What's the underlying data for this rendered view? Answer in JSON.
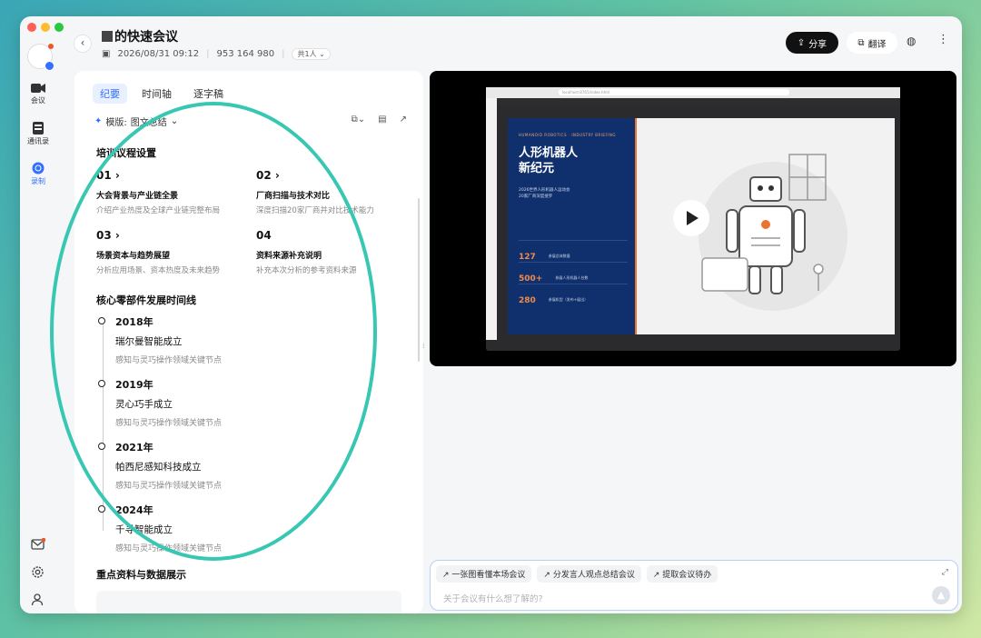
{
  "colors": {
    "accent": "#3370ff",
    "annotation": "#38c7b3",
    "slide_navy": "#10306d",
    "slide_orange": "#e8742f"
  },
  "sidebar": {
    "items": [
      {
        "label": "会议",
        "icon": "video-camera-icon"
      },
      {
        "label": "通讯录",
        "icon": "contacts-icon"
      },
      {
        "label": "录制",
        "icon": "record-icon"
      }
    ],
    "bottom_icons": [
      "mail-icon",
      "gear-icon",
      "person-icon"
    ]
  },
  "header": {
    "title": "的快速会议",
    "datetime": "2026/08/31 09:12",
    "meeting_id": "953 164 980",
    "participants": "共1人",
    "share_label": "分享",
    "translate_label": "翻译"
  },
  "panel": {
    "tabs": [
      "纪要",
      "时间轴",
      "逐字稿"
    ],
    "template_label": "模版:",
    "template_value": "图文总结",
    "section_agenda": "培训议程设置",
    "agenda": [
      {
        "num": "01 ›",
        "title": "大会背景与产业链全景",
        "desc": "介绍产业热度及全球产业链完整布局"
      },
      {
        "num": "02 ›",
        "title": "厂商扫描与技术对比",
        "desc": "深度扫描20家厂商并对比技术能力"
      },
      {
        "num": "03 ›",
        "title": "场景资本与趋势展望",
        "desc": "分析应用场景、资本热度及未来趋势"
      },
      {
        "num": "04",
        "title": "资料来源补充说明",
        "desc": "补充本次分析的参考资料来源"
      }
    ],
    "section_timeline": "核心零部件发展时间线",
    "timeline": [
      {
        "year": "2018年",
        "name": "瑞尔曼智能成立",
        "desc": "感知与灵巧操作领域关键节点"
      },
      {
        "year": "2019年",
        "name": "灵心巧手成立",
        "desc": "感知与灵巧操作领域关键节点"
      },
      {
        "year": "2021年",
        "name": "帕西尼感知科技成立",
        "desc": "感知与灵巧操作领域关键节点"
      },
      {
        "year": "2024年",
        "name": "千寻智能成立",
        "desc": "感知与灵巧操作领域关键节点"
      }
    ],
    "section_data": "重点资料与数据展示"
  },
  "video": {
    "url": "localhost:8765/index.html",
    "slide_kicker": "HUMANOID ROBOTICS · INDUSTRY BRIEFING",
    "slide_title_1": "人形机器人",
    "slide_title_2": "新纪元",
    "slide_sub_1": "2026世界人形机器人运动会",
    "slide_sub_2": "20家厂商深度搜罗",
    "stats": [
      {
        "value": "127",
        "label": "参展总体数量"
      },
      {
        "value": "500+",
        "label": "参展人形机器人台数"
      },
      {
        "value": "280",
        "label": "参展机型（发布+展出）"
      }
    ]
  },
  "qa": {
    "chips": [
      "一张图看懂本场会议",
      "分发言人观点总结会议",
      "提取会议待办"
    ],
    "placeholder": "关于会议有什么想了解的?"
  }
}
